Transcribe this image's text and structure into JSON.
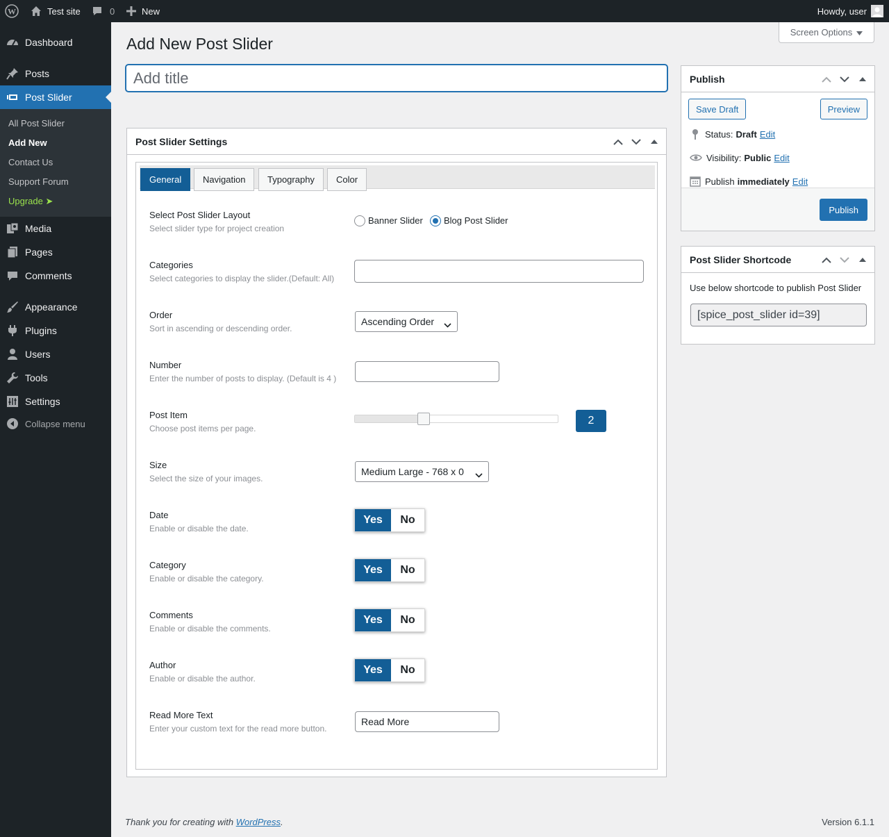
{
  "adminbar": {
    "site_name": "Test site",
    "comments_count": "0",
    "new_label": "New",
    "howdy": "Howdy, user"
  },
  "sidebar": {
    "dashboard": "Dashboard",
    "posts": "Posts",
    "post_slider": "Post Slider",
    "submenu": {
      "all": "All Post Slider",
      "add_new": "Add New",
      "contact": "Contact Us",
      "support": "Support Forum",
      "upgrade": "Upgrade ➤"
    },
    "media": "Media",
    "pages": "Pages",
    "comments": "Comments",
    "appearance": "Appearance",
    "plugins": "Plugins",
    "users": "Users",
    "tools": "Tools",
    "settings": "Settings",
    "collapse": "Collapse menu"
  },
  "screen_options": "Screen Options",
  "page_title": "Add New Post Slider",
  "title_placeholder": "Add title",
  "settings": {
    "box_title": "Post Slider Settings",
    "tabs": [
      "General",
      "Navigation",
      "Typography",
      "Color"
    ],
    "active_tab": "General",
    "fields": {
      "layout": {
        "label": "Select Post Slider Layout",
        "desc": "Select slider type for project creation",
        "options": [
          "Banner Slider",
          "Blog Post Slider"
        ],
        "selected": "Blog Post Slider"
      },
      "categories": {
        "label": "Categories",
        "desc": "Select categories to display the slider.(Default: All)",
        "value": ""
      },
      "order": {
        "label": "Order",
        "desc": "Sort in ascending or descending order.",
        "value": "Ascending Order"
      },
      "number": {
        "label": "Number",
        "desc": "Enter the number of posts to display. (Default is 4 )",
        "value": ""
      },
      "post_item": {
        "label": "Post Item",
        "desc": "Choose post items per page.",
        "value": "2",
        "slider_fraction": 0.34
      },
      "size": {
        "label": "Size",
        "desc": "Select the size of your images.",
        "value": "Medium Large - 768 x 0"
      },
      "date": {
        "label": "Date",
        "desc": "Enable or disable the date.",
        "yes": "Yes",
        "no": "No"
      },
      "category": {
        "label": "Category",
        "desc": "Enable or disable the category.",
        "yes": "Yes",
        "no": "No"
      },
      "comments": {
        "label": "Comments",
        "desc": "Enable or disable the comments.",
        "yes": "Yes",
        "no": "No"
      },
      "author": {
        "label": "Author",
        "desc": "Enable or disable the author.",
        "yes": "Yes",
        "no": "No"
      },
      "read_more": {
        "label": "Read More Text",
        "desc": "Enter your custom text for the read more button.",
        "value": "Read More"
      }
    }
  },
  "publish": {
    "title": "Publish",
    "save_draft": "Save Draft",
    "preview": "Preview",
    "status_label": "Status:",
    "status_value": "Draft",
    "visibility_label": "Visibility:",
    "visibility_value": "Public",
    "publish_label": "Publish",
    "publish_value": "immediately",
    "edit": "Edit",
    "publish_button": "Publish"
  },
  "shortcode": {
    "title": "Post Slider Shortcode",
    "desc": "Use below shortcode to publish Post Slider",
    "value": "[spice_post_slider id=39]"
  },
  "footer": {
    "thanks_prefix": "Thank you for creating with ",
    "link": "WordPress",
    "thanks_suffix": ".",
    "version": "Version 6.1.1"
  },
  "colors": {
    "admin_dark": "#1d2327",
    "accent": "#2271b1",
    "accent_dark": "#135e96",
    "upgrade": "#9be34d"
  }
}
